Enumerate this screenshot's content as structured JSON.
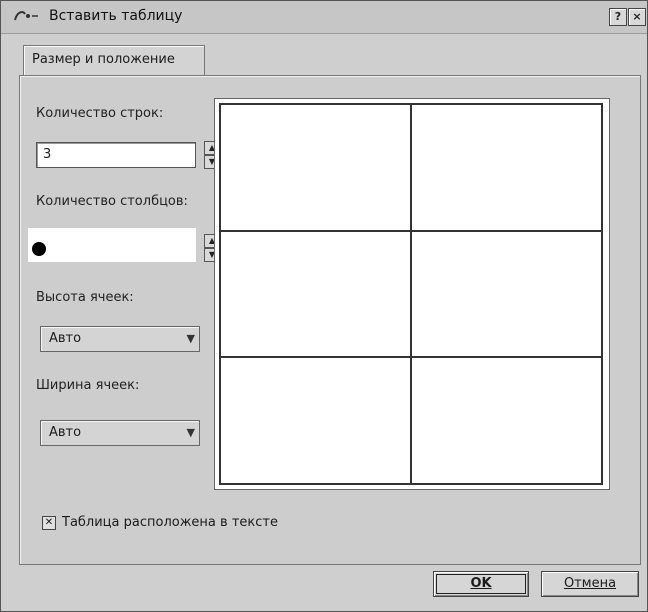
{
  "window": {
    "title": "Вставить таблицу",
    "help_label": "?",
    "close_label": "×"
  },
  "tabs": [
    {
      "label": "Размер и положение"
    }
  ],
  "rows": {
    "label": "Количество строк:",
    "value": "3"
  },
  "columns": {
    "label": "Количество столбцов:",
    "value": ""
  },
  "spin": {
    "up": "▲",
    "down": "▼"
  },
  "cell_height": {
    "label": "Высота ячеек:",
    "value": "Авто"
  },
  "cell_width": {
    "label": "Ширина ячеек:",
    "value": "Авто"
  },
  "preview": {
    "rows": 3,
    "columns": 2
  },
  "in_text": {
    "label": "Таблица расположена в тексте",
    "checked": true,
    "mark": "✕"
  },
  "buttons": {
    "ok": "OK",
    "cancel": "Отмена"
  }
}
